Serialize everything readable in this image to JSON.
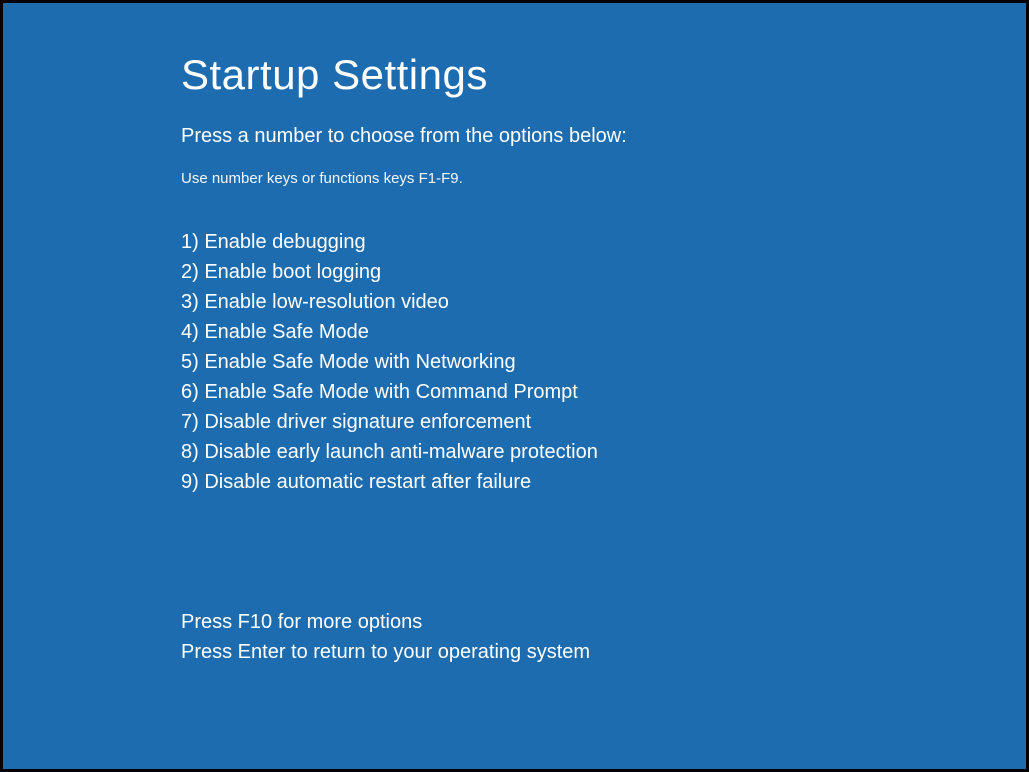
{
  "header": {
    "title": "Startup Settings",
    "instruction": "Press a number to choose from the options below:",
    "subinstruction": "Use number keys or functions keys F1-F9."
  },
  "options": [
    "1) Enable debugging",
    "2) Enable boot logging",
    "3) Enable low-resolution video",
    "4) Enable Safe Mode",
    "5) Enable Safe Mode with Networking",
    "6) Enable Safe Mode with Command Prompt",
    "7) Disable driver signature enforcement",
    "8) Disable early launch anti-malware protection",
    "9) Disable automatic restart after failure"
  ],
  "footer": {
    "more_options": "Press F10 for more options",
    "return": "Press Enter to return to your operating system"
  }
}
